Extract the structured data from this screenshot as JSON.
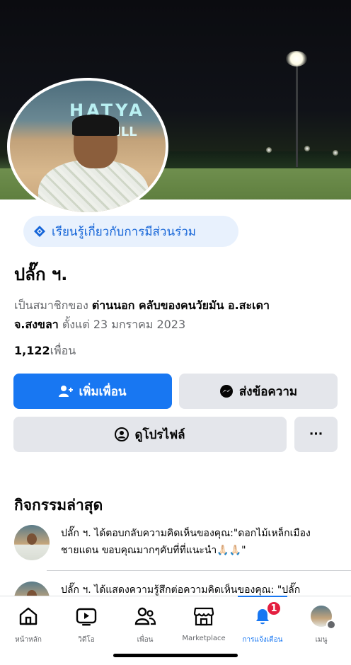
{
  "profile": {
    "engagement_pill": "เรียนรู้เกี่ยวกับการมีส่วนร่วม",
    "name": "ปลั๊ก ฯ.",
    "member_prefix": "เป็นสมาชิกของ",
    "group_name_line1": "ต่านนอก คลับของคนวัยมัน อ.สะเดา",
    "group_name_line2": "จ.สงขลา",
    "member_since": "ตั้งแต่ 23 มกราคม  2023",
    "friends_count": "1,122",
    "friends_label": "เพื่อน",
    "avatar_sign": "HATYA",
    "avatar_sign2": "ILL"
  },
  "actions": {
    "add_friend": "เพิ่มเพื่อน",
    "message": "ส่งข้อความ",
    "view_profile": "ดูโปรไฟล์",
    "more": "···"
  },
  "activity": {
    "title": "กิจกรรมล่าสุด",
    "items": [
      {
        "text": "ปลั๊ก ฯ.  ได้ตอบกลับความคิดเห็นของคุณ:\"ดอกไม้เหล็กเมืองชายแดน ขอบคุณมากๆคับที่ที่แนะนำ🙏🏻🙏🏻\""
      },
      {
        "text": "ปลั๊ก ฯ.  ได้แสดงความรู้สึกต่อความคิดเห็นของคุณ: \"ปลั๊ก"
      }
    ]
  },
  "bottom_nav": {
    "items": [
      {
        "label": "หน้าหลัก",
        "icon": "home-icon"
      },
      {
        "label": "วิดีโอ",
        "icon": "video-icon"
      },
      {
        "label": "เพื่อน",
        "icon": "friends-icon"
      },
      {
        "label": "Marketplace",
        "icon": "marketplace-icon"
      },
      {
        "label": "การแจ้งเตือน",
        "icon": "bell-icon",
        "badge": "1"
      },
      {
        "label": "เมนู",
        "icon": "menu-avatar-icon"
      }
    ]
  },
  "colors": {
    "primary": "#1877f2",
    "button_gray": "#e4e6eb",
    "badge_red": "#e41e3f",
    "pill_bg": "#e8f1fd"
  }
}
